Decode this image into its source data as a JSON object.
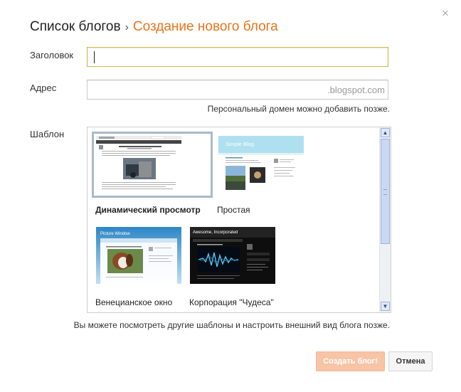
{
  "dialog": {
    "close_glyph": "×",
    "breadcrumb": {
      "parent": "Список блогов",
      "separator": "›",
      "current": "Создание нового блога"
    },
    "fields": {
      "title_label": "Заголовок",
      "title_value": "",
      "address_label": "Адрес",
      "address_value": "",
      "address_suffix": ".blogspot.com",
      "domain_hint": "Персональный домен можно добавить позже.",
      "template_label": "Шаблон"
    },
    "templates": [
      {
        "name": "Динамический просмотр",
        "selected": true
      },
      {
        "name": "Простая",
        "selected": false
      },
      {
        "name": "Венецианское окно",
        "selected": false
      },
      {
        "name": "Корпорация \"Чудеса\"",
        "selected": false
      }
    ],
    "template_hint": "Вы можете посмотреть другие шаблоны и настроить внешний вид блога позже.",
    "buttons": {
      "create": "Создать блог!",
      "cancel": "Отмена"
    },
    "thumb_text": {
      "simple": "Simple Blog",
      "picture_window": "Picture Window",
      "awesome": "Awesome, Incorporated"
    }
  },
  "colors": {
    "accent": "#e8741c",
    "create_button": "#f7c4a6",
    "focus_border": "#d2b54a",
    "selection_frame": "#a8b9cc"
  }
}
